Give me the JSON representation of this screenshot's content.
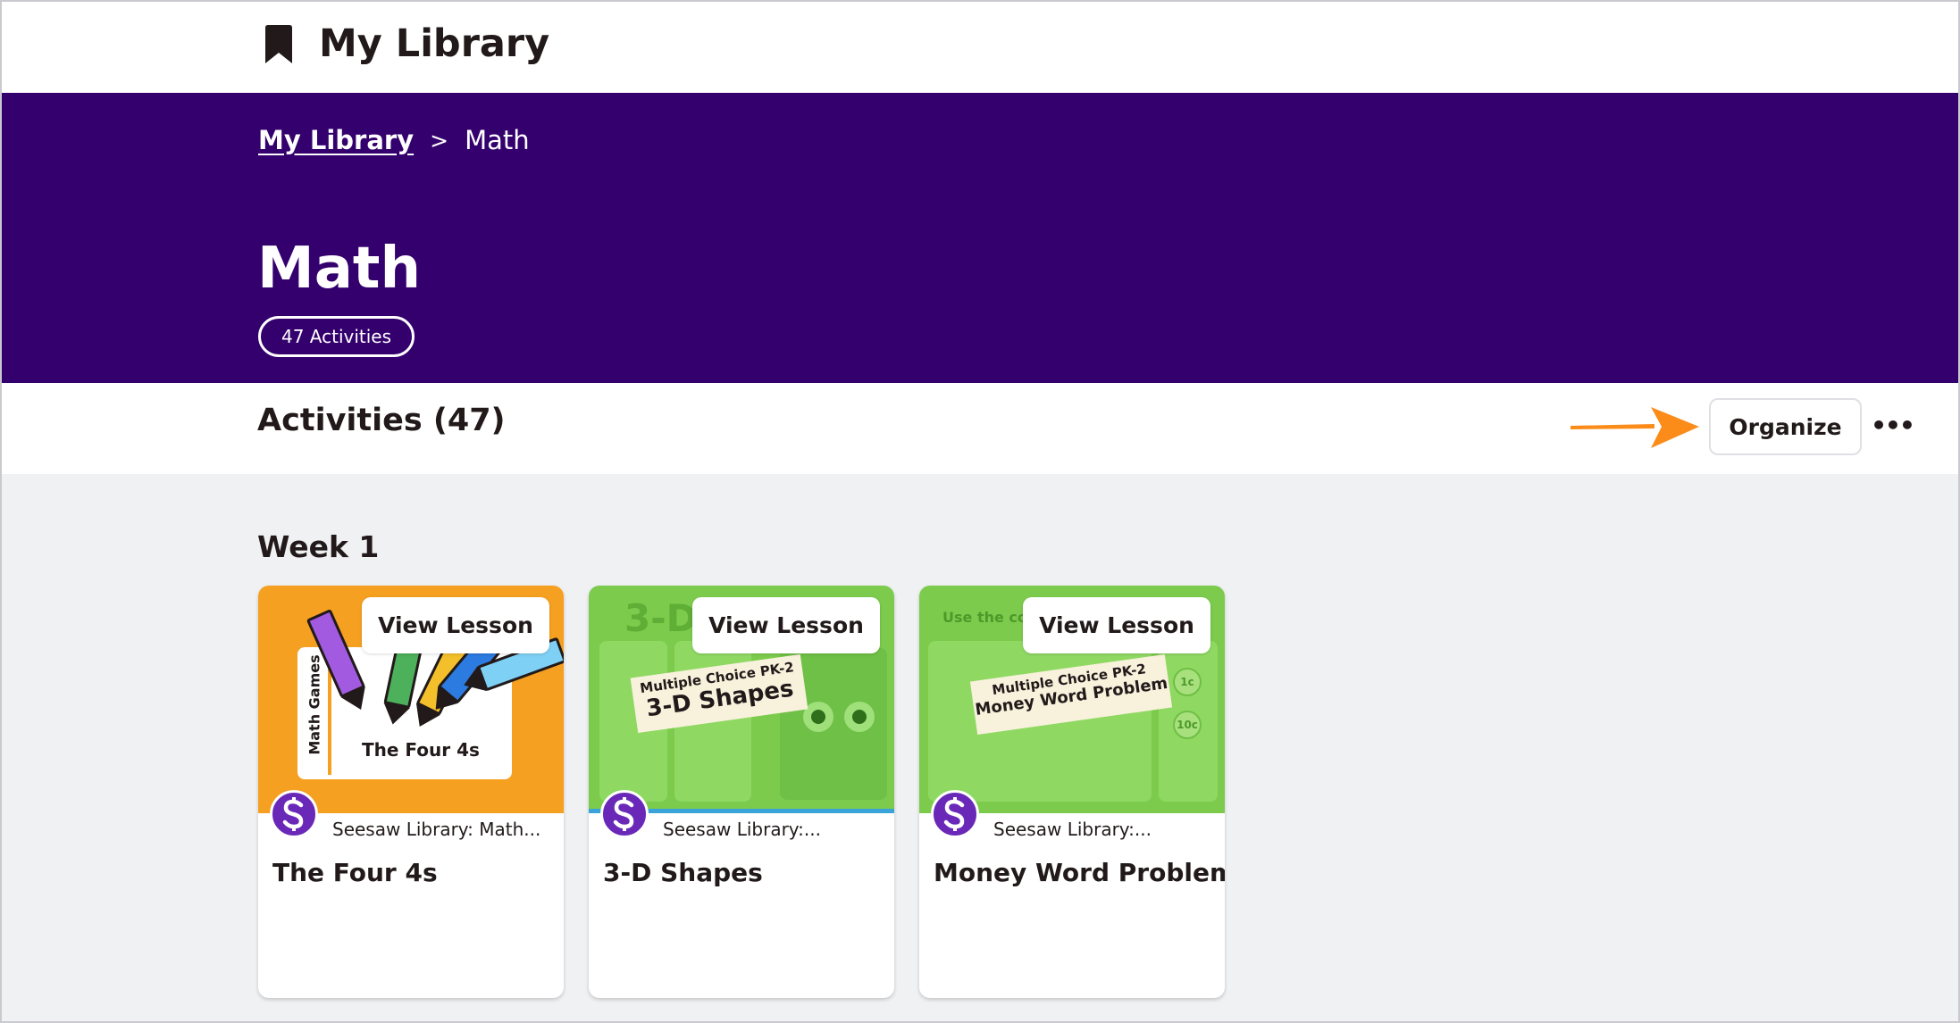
{
  "header": {
    "app_title": "My Library",
    "icon": "bookmark-icon"
  },
  "hero": {
    "breadcrumb_root": "My Library",
    "breadcrumb_separator": ">",
    "breadcrumb_current": "Math",
    "page_title": "Math",
    "activity_count_badge": "47 Activities",
    "background_color": "#34006e"
  },
  "activities_header": {
    "title": "Activities (47)",
    "organize_label": "Organize",
    "more_label": "•••",
    "more_icon": "more-icon",
    "annotation_arrow_color": "#fb8c1a"
  },
  "section": {
    "week_title": "Week 1"
  },
  "cards": [
    {
      "view_label": "View Lesson",
      "source": "Seesaw Library: Math...",
      "title": "The Four 4s",
      "thumb_side_text": "Math Games",
      "thumb_text": "The Four 4s"
    },
    {
      "view_label": "View Lesson",
      "source": "Seesaw Library:...",
      "title": "3-D Shapes",
      "thumb_big_text": "3-D",
      "banner_small": "Multiple Choice  PK-2",
      "banner_big": "3-D Shapes"
    },
    {
      "view_label": "View Lesson",
      "source": "Seesaw Library:...",
      "title": "Money Word Problem",
      "thumb_big_text": "Use the coir",
      "banner_small": "Multiple Choice  PK-2",
      "banner_big": "Money Word Problem",
      "coin_1": "1c",
      "coin_2": "10c"
    }
  ],
  "colors": {
    "hero_purple": "#34006e",
    "card_orange": "#f5a020",
    "card_green": "#7ccb4c",
    "avatar_purple": "#6a28b8"
  }
}
